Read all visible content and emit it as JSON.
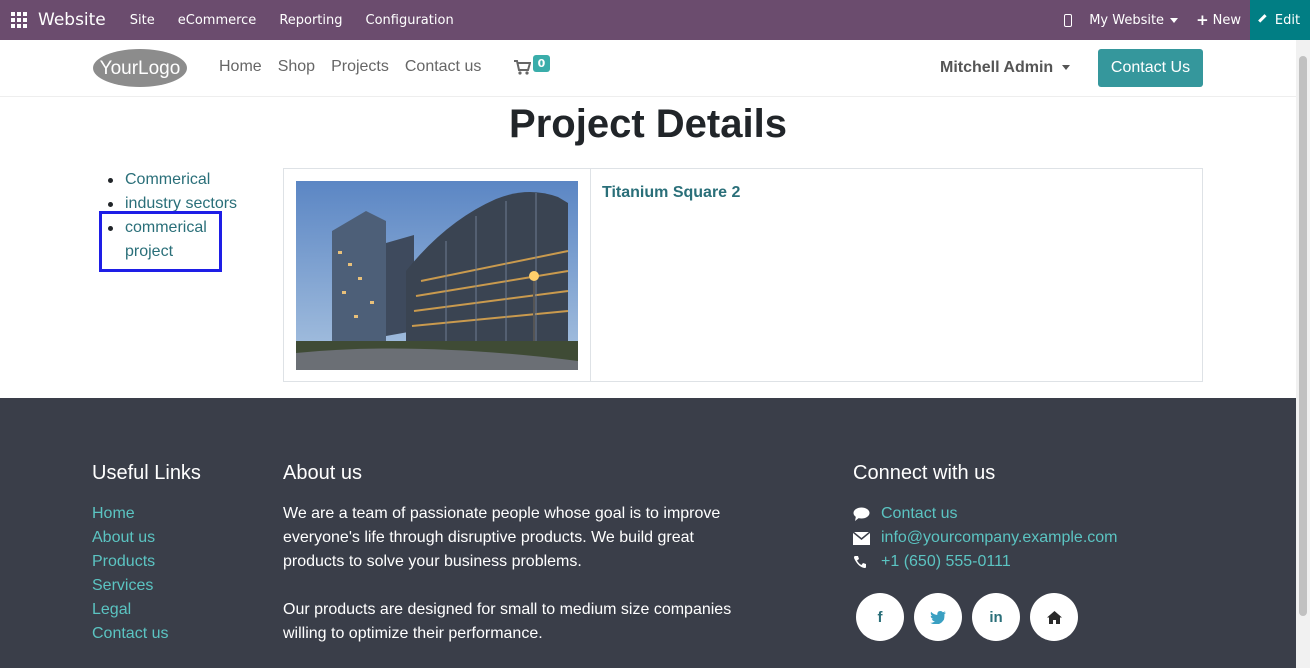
{
  "admin_bar": {
    "brand": "Website",
    "menu": [
      "Site",
      "eCommerce",
      "Reporting",
      "Configuration"
    ],
    "website_selector": "My Website",
    "new_label": "New",
    "edit_label": "Edit"
  },
  "header": {
    "logo_text": "YourLogo",
    "nav": [
      "Home",
      "Shop",
      "Projects",
      "Contact us"
    ],
    "cart_count": "0",
    "user": "Mitchell Admin",
    "contact_button": "Contact Us"
  },
  "main": {
    "title": "Project Details",
    "categories": [
      "Commerical",
      "industry sectors",
      "commerical project"
    ],
    "project": {
      "name": "Titanium Square 2"
    }
  },
  "footer": {
    "useful_links_title": "Useful Links",
    "useful_links": [
      "Home",
      "About us",
      "Products",
      "Services",
      "Legal",
      "Contact us"
    ],
    "about_title": "About us",
    "about_p1": "We are a team of passionate people whose goal is to improve everyone's life through disruptive products. We build great products to solve your business problems.",
    "about_p2": "Our products are designed for small to medium size companies willing to optimize their performance.",
    "connect_title": "Connect with us",
    "connect": {
      "contact": "Contact us",
      "email": "info@yourcompany.example.com",
      "phone": "+1 (650) 555-0111"
    },
    "socials": [
      "f",
      "t",
      "in",
      "home"
    ]
  },
  "colors": {
    "admin_bar": "#6b4c6e",
    "edit_button": "#017e84",
    "primary": "#35979c",
    "link": "#2a6f79",
    "footer_bg": "#3a3e49",
    "footer_link": "#5bc4c2",
    "highlight_box": "#1e1ee6"
  }
}
